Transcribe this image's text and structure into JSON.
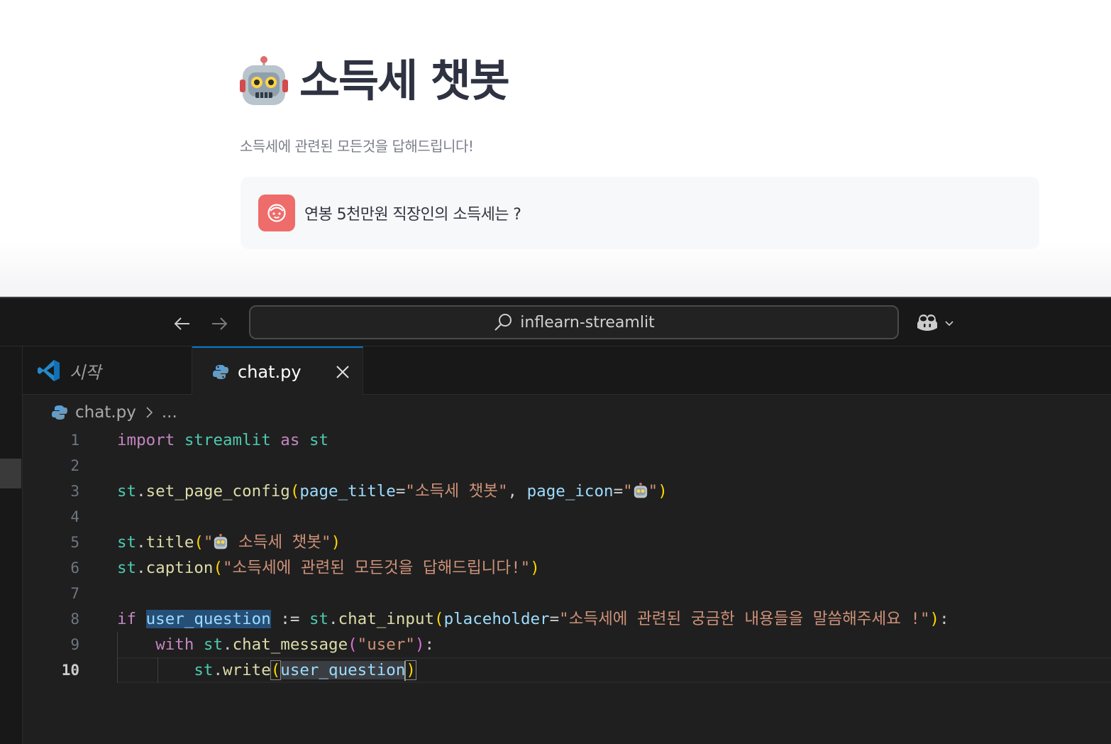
{
  "streamlit": {
    "title": "소득세 챗봇",
    "caption": "소득세에 관련된 모든것을 답해드립니다!",
    "chat_message": {
      "role": "user",
      "text": "연봉 5천만원 직장인의 소득세는 ?"
    },
    "colors": {
      "avatar_bg": "#ee6c6a",
      "title": "#2f3241"
    }
  },
  "vscode": {
    "command_center": {
      "text": "inflearn-streamlit",
      "icon": "search-icon"
    },
    "tabs": [
      {
        "label": "시작",
        "icon": "vscode-logo-icon",
        "active": false
      },
      {
        "label": "chat.py",
        "icon": "python-icon",
        "active": true
      }
    ],
    "breadcrumb": {
      "file": "chat.py",
      "more": "..."
    },
    "line_numbers": [
      "1",
      "2",
      "3",
      "4",
      "5",
      "6",
      "7",
      "8",
      "9",
      "10"
    ],
    "code": {
      "l1": {
        "kw": "import",
        "mod": "streamlit",
        "as": "as",
        "alias": "st"
      },
      "l3": {
        "obj": "st",
        "fn": "set_page_config",
        "p1": "page_title",
        "v1": "\"소득세 챗봇\"",
        "p2": "page_icon",
        "v2a": "\"",
        "v2b": "\""
      },
      "l5": {
        "obj": "st",
        "fn": "title",
        "s1": "\"",
        "s2": " 소득세 챗봇\""
      },
      "l6": {
        "obj": "st",
        "fn": "caption",
        "s": "\"소득세에 관련된 모든것을 답해드립니다!\""
      },
      "l8": {
        "kw": "if",
        "var": "user_question",
        "op": " := ",
        "obj": "st",
        "fn": "chat_input",
        "param": "placeholder",
        "s": "\"소득세에 관련된 궁금한 내용들을 말씀해주세요 !\""
      },
      "l9": {
        "kw": "with",
        "obj": "st",
        "fn": "chat_message",
        "s": "\"user\""
      },
      "l10": {
        "obj": "st",
        "fn": "write",
        "var": "user_question"
      }
    },
    "active_line": "10"
  }
}
